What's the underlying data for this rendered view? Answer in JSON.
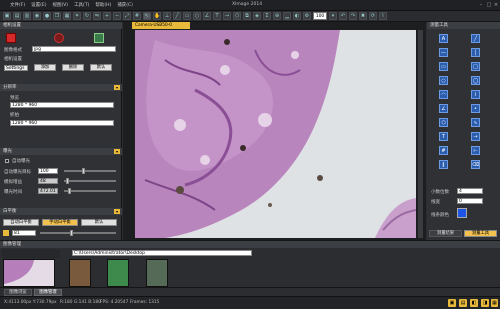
{
  "titlebar": {
    "menu": [
      "文件(F)",
      "设置(E)",
      "视图(V)",
      "工具(T)",
      "帮助(H)",
      "捕获(C)"
    ],
    "title": "XImage 2014"
  },
  "toolbar": {
    "zoom": "100"
  },
  "left": {
    "header": "相机设置",
    "format_label": "图像格式",
    "format_value": "jpg",
    "params_header": "相机设置",
    "settings_value": "Settings",
    "btn_add": "添加",
    "btn_delete": "删除",
    "btn_default": "默认",
    "res_header": "分辨率",
    "res_label1": "预览",
    "res_value1": "1280 * 960",
    "res_label2": "抓拍",
    "res_value2": "1280 * 960",
    "exposure_header": "曝光",
    "auto_exposure": "自动曝光",
    "target_label": "自动曝光目标",
    "target_value": "100",
    "gain_label": "模拟增益",
    "gain_value": "48",
    "time_label": "曝光时间",
    "time_value": "472.01",
    "wb_header": "白平衡",
    "wb_auto": "自动白平衡",
    "wb_manual": "手动白平衡",
    "wb_default": "默认",
    "wb_value": "81"
  },
  "tab": {
    "label": "Camera-USB50-0"
  },
  "right": {
    "header": "测量工具",
    "count_label": "小数位数",
    "count_value": "4",
    "width_label": "线宽",
    "width_value": "0",
    "color_label": "线条颜色",
    "btn_left": "测量结果",
    "btn_right": "测量工具",
    "colors": {
      "swatch": "#1d56e6"
    }
  },
  "bottom": {
    "header": "图像管理",
    "tab1": "图像浏览",
    "tab2": "图像管理",
    "path": "C:\\Users\\Administrator\\Desktop"
  },
  "status": {
    "coords": "X:4113.00px Y:730.79px",
    "rgb": "R:180 G:141 B:180",
    "fps": "FPS: 4.20547",
    "frames": "Frames: 1315"
  }
}
